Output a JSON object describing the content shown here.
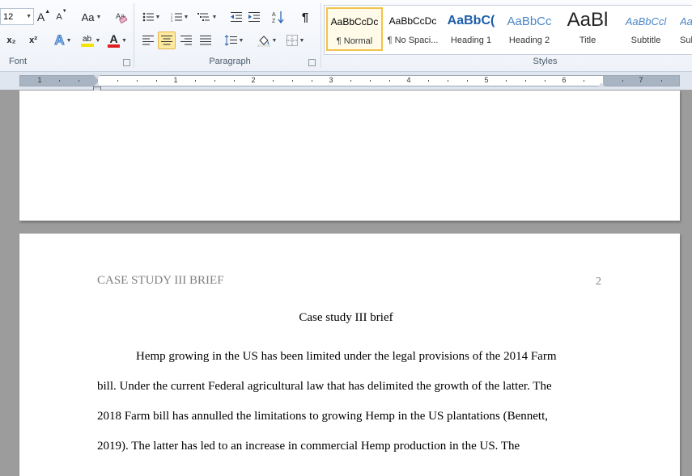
{
  "font_group": {
    "label": "Font",
    "font_size": "12",
    "grow_label": "A",
    "shrink_label": "A",
    "change_case_label": "Aa",
    "subscript_label": "x₂",
    "superscript_label": "x²",
    "text_effects_label": "A",
    "highlight_label": "ab",
    "font_color_label": "A",
    "highlight_color": "#f5e300",
    "font_color": "#e02020"
  },
  "paragraph_group": {
    "label": "Paragraph",
    "pilcrow": "¶",
    "sort_label": "A↓"
  },
  "styles_group": {
    "label": "Styles",
    "items": [
      {
        "sample": "AaBbCcDc",
        "name": "¶ Normal"
      },
      {
        "sample": "AaBbCcDc",
        "name": "¶ No Spaci..."
      },
      {
        "sample": "AaBbC(",
        "name": "Heading 1"
      },
      {
        "sample": "AaBbCc",
        "name": "Heading 2"
      },
      {
        "sample": "AaBl",
        "name": "Title"
      },
      {
        "sample": "AaBbCcl",
        "name": "Subtitle"
      },
      {
        "sample": "Aa",
        "name": "Sub"
      }
    ]
  },
  "ruler": {
    "numbers": [
      "1",
      "1",
      "2",
      "3",
      "4",
      "5",
      "6",
      "7"
    ]
  },
  "document": {
    "page": 2,
    "header_title": "CASE STUDY III BRIEF",
    "header_page_number": "2",
    "title": "Case study III brief",
    "lines": [
      "Hemp growing in the US has been limited under the legal provisions of the 2014 Farm",
      "bill. Under the current Federal agricultural law that has delimited the growth of the latter.  The",
      "2018 Farm bill has annulled the limitations to growing Hemp in the US plantations (Bennett,",
      "2019). The latter has led to an increase in commercial Hemp production in the US. The"
    ]
  }
}
